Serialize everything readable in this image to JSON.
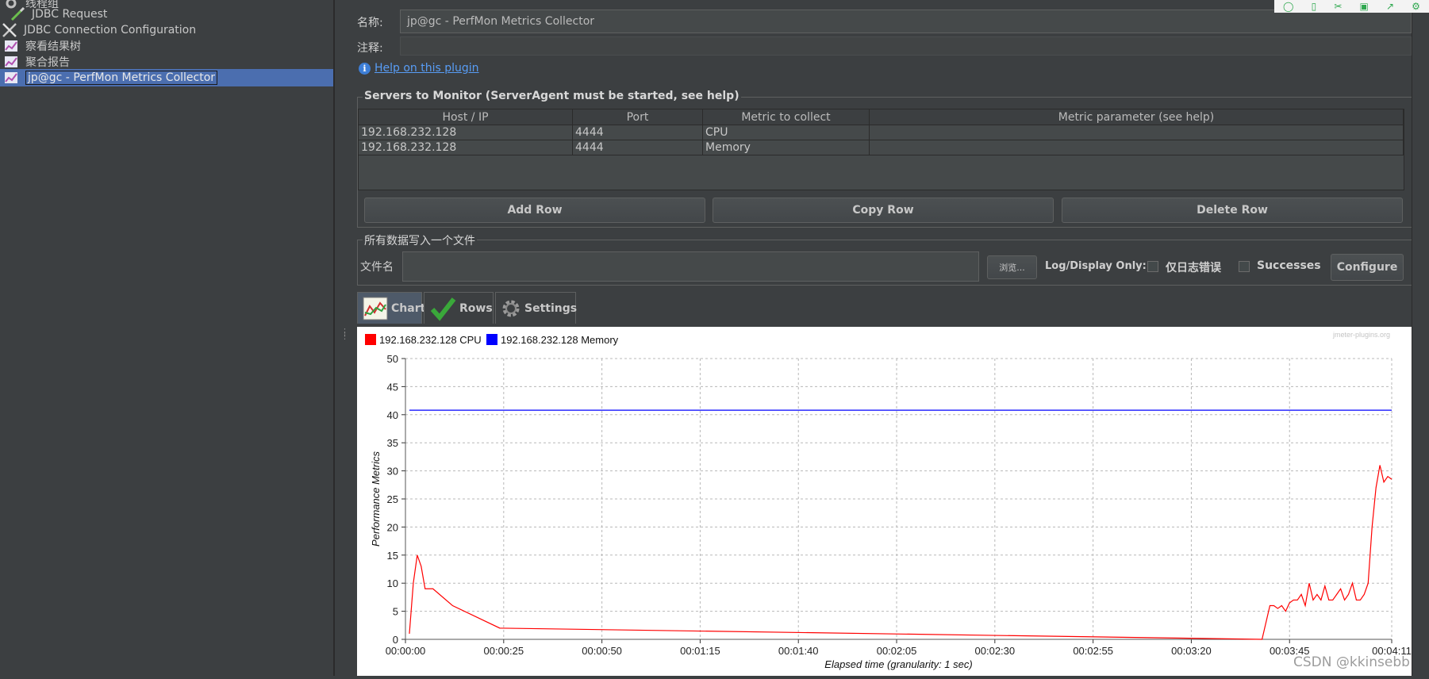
{
  "tree": {
    "items": [
      {
        "label": "线程组",
        "icon": "gear-icon"
      },
      {
        "label": "JDBC Request",
        "icon": "pipette-icon"
      },
      {
        "label": "JDBC Connection Configuration",
        "icon": "tools-icon"
      },
      {
        "label": "察看结果树",
        "icon": "graph-icon"
      },
      {
        "label": "聚合报告",
        "icon": "graph-icon"
      },
      {
        "label": "jp@gc - PerfMon Metrics Collector",
        "icon": "graph-icon",
        "selected": true
      }
    ]
  },
  "form": {
    "name_label": "名称:",
    "name_value": "jp@gc - PerfMon Metrics Collector",
    "comment_label": "注释:",
    "comment_value": "",
    "help_link": "Help on this plugin"
  },
  "servers": {
    "title": "Servers to Monitor (ServerAgent must be started, see help)",
    "columns": [
      "Host / IP",
      "Port",
      "Metric to collect",
      "Metric parameter (see help)"
    ],
    "rows": [
      [
        "192.168.232.128",
        "4444",
        "CPU",
        ""
      ],
      [
        "192.168.232.128",
        "4444",
        "Memory",
        ""
      ]
    ],
    "buttons": {
      "add": "Add Row",
      "copy": "Copy Row",
      "delete": "Delete Row"
    }
  },
  "file": {
    "title": "所有数据写入一个文件",
    "filename_label": "文件名",
    "filename_value": "",
    "browse": "浏览...",
    "log_display_label": "Log/Display Only:",
    "errors_only_label": "仅日志错误",
    "errors_only_checked": false,
    "successes_label": "Successes",
    "successes_checked": false,
    "configure": "Configure"
  },
  "tabs": [
    {
      "label": "Chart",
      "icon": "chart-icon",
      "active": true
    },
    {
      "label": "Rows",
      "icon": "checkmark-icon",
      "active": false
    },
    {
      "label": "Settings",
      "icon": "gear-icon",
      "active": false
    }
  ],
  "chart_data": {
    "type": "line",
    "watermark": "jmeter-plugins.org",
    "xlabel": "Elapsed time (granularity: 1 sec)",
    "ylabel": "Performance Metrics",
    "ylim": [
      0,
      50
    ],
    "yticks": [
      0,
      5,
      10,
      15,
      20,
      25,
      30,
      35,
      40,
      45,
      50
    ],
    "xlim": [
      0,
      251
    ],
    "xticks": [
      {
        "t": 0,
        "label": "00:00:00"
      },
      {
        "t": 25,
        "label": "00:00:25"
      },
      {
        "t": 50,
        "label": "00:00:50"
      },
      {
        "t": 75,
        "label": "00:01:15"
      },
      {
        "t": 100,
        "label": "00:01:40"
      },
      {
        "t": 125,
        "label": "00:02:05"
      },
      {
        "t": 150,
        "label": "00:02:30"
      },
      {
        "t": 175,
        "label": "00:02:55"
      },
      {
        "t": 200,
        "label": "00:03:20"
      },
      {
        "t": 225,
        "label": "00:03:45"
      },
      {
        "t": 251,
        "label": "00:04:11"
      }
    ],
    "grid": true,
    "legend_position": "top-left",
    "series": [
      {
        "name": "192.168.232.128 CPU",
        "color": "#ff0000",
        "x": [
          1,
          2,
          3,
          4,
          5,
          7,
          12,
          24,
          218,
          220,
          221,
          222,
          223,
          224,
          225,
          226,
          227,
          228,
          229,
          230,
          231,
          232,
          233,
          234,
          235,
          236,
          237,
          238,
          239,
          240,
          241,
          242,
          243,
          244,
          245,
          246,
          247,
          248,
          249,
          250,
          251
        ],
        "y": [
          1,
          10,
          15,
          13,
          9,
          9,
          6,
          2,
          0,
          6,
          6,
          5.5,
          6,
          5,
          6.5,
          7,
          7,
          8,
          6,
          10,
          7,
          8,
          7,
          9.5,
          7,
          7,
          8,
          9,
          7,
          8,
          10,
          7,
          7,
          8,
          10,
          20,
          27,
          31,
          28,
          29,
          28.5
        ]
      },
      {
        "name": "192.168.232.128 Memory",
        "color": "#0000ff",
        "x": [
          1,
          251
        ],
        "y": [
          40.8,
          40.8
        ]
      }
    ]
  },
  "watermark": "CSDN @kkinsebb"
}
